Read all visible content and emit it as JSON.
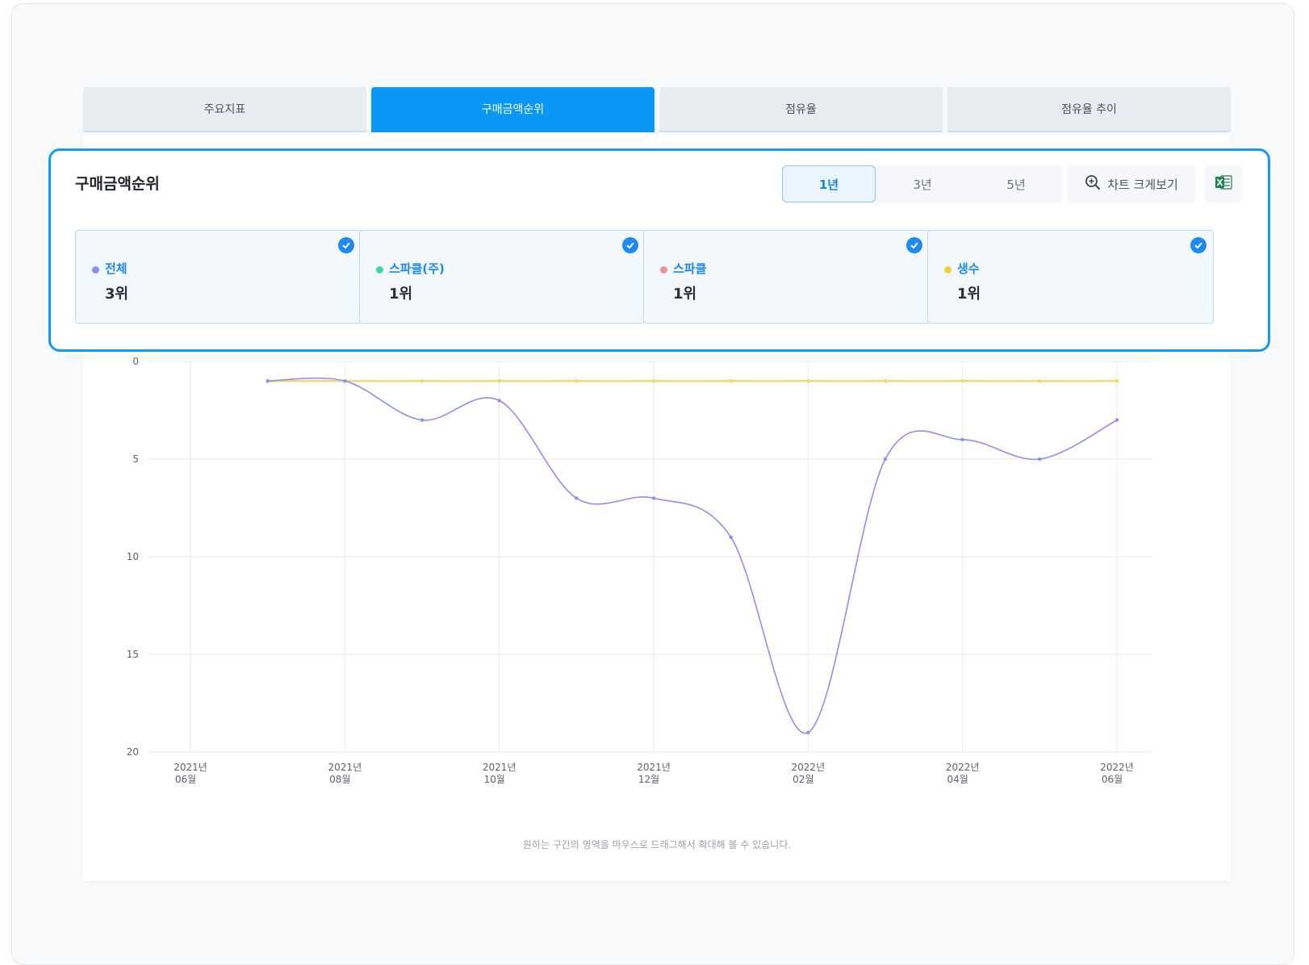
{
  "tabs": [
    {
      "label": "주요지표",
      "active": false
    },
    {
      "label": "구매금액순위",
      "active": true
    },
    {
      "label": "점유율",
      "active": false
    },
    {
      "label": "점유율 추이",
      "active": false
    }
  ],
  "panel": {
    "title": "구매금액순위",
    "periods": [
      {
        "label": "1년",
        "active": true
      },
      {
        "label": "3년",
        "active": false
      },
      {
        "label": "5년",
        "active": false
      }
    ],
    "zoom_label": "차트 크게보기",
    "excel_icon": "excel-icon"
  },
  "cards": [
    {
      "name": "전체",
      "rank": "3위",
      "color": "#8a8ff2",
      "checked": true
    },
    {
      "name": "스파클(주)",
      "rank": "1위",
      "color": "#3ed6b4",
      "checked": true
    },
    {
      "name": "스파클",
      "rank": "1위",
      "color": "#f2918f",
      "checked": true
    },
    {
      "name": "생수",
      "rank": "1위",
      "color": "#f5cc3c",
      "checked": true
    }
  ],
  "chart_data": {
    "type": "line",
    "y_reversed": true,
    "ylim": [
      0,
      20
    ],
    "yticks": [
      "0",
      "5",
      "10",
      "15",
      "20"
    ],
    "x_tick_labels": [
      [
        "2021년",
        "06월"
      ],
      [
        "2021년",
        "08월"
      ],
      [
        "2021년",
        "10월"
      ],
      [
        "2021년",
        "12월"
      ],
      [
        "2022년",
        "02월"
      ],
      [
        "2022년",
        "04월"
      ],
      [
        "2022년",
        "06월"
      ]
    ],
    "x": [
      "2021-07",
      "2021-08",
      "2021-09",
      "2021-10",
      "2021-11",
      "2021-12",
      "2022-01",
      "2022-02",
      "2022-03",
      "2022-04",
      "2022-05",
      "2022-06"
    ],
    "x_domain": [
      "2021-06",
      "2022-06"
    ],
    "series": [
      {
        "name": "전체",
        "color": "#8a8ff2",
        "values": [
          1,
          1,
          3,
          2,
          7,
          7,
          9,
          19,
          5,
          4,
          5,
          3
        ]
      },
      {
        "name": "스파클(주)",
        "color": "#3ed6b4",
        "values": [
          1,
          1,
          1,
          1,
          1,
          1,
          1,
          1,
          1,
          1,
          1,
          1
        ]
      },
      {
        "name": "스파클",
        "color": "#f2918f",
        "values": [
          1,
          1,
          1,
          1,
          1,
          1,
          1,
          1,
          1,
          1,
          1,
          1
        ]
      },
      {
        "name": "생수",
        "color": "#f5dd6c",
        "values": [
          1,
          1,
          1,
          1,
          1,
          1,
          1,
          1,
          1,
          1,
          1,
          1
        ]
      }
    ],
    "grid": true
  },
  "hint": "원하는 구간의 영역을 마우스로 드래그해서 확대해 볼 수 있습니다."
}
